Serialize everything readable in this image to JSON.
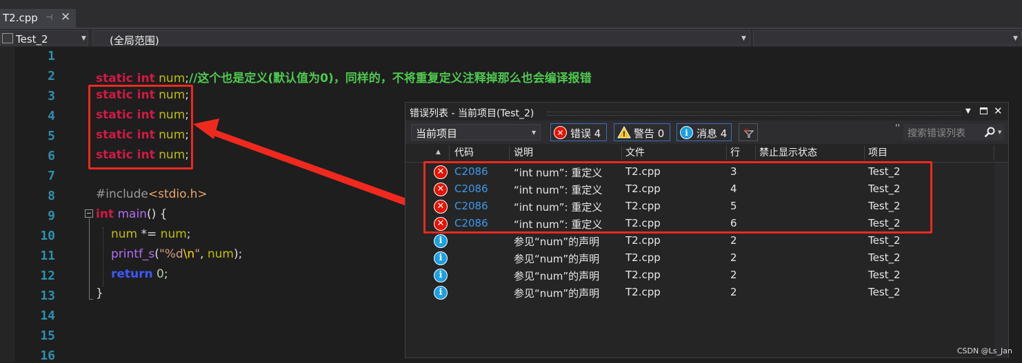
{
  "tab": {
    "title": "T2.cpp",
    "pin": "⊣",
    "close": "✕"
  },
  "nav": {
    "project": "Test_2",
    "scope": "(全局范围)"
  },
  "editor": {
    "line_numbers": [
      "1",
      "2",
      "3",
      "4",
      "5",
      "6",
      "7",
      "8",
      "9",
      "10",
      "11",
      "12",
      "13",
      "14",
      "15",
      "16"
    ],
    "line2": {
      "kw": "static int",
      "var": "num",
      "punct": ";",
      "comment": "//这个也是定义(默认值为0)，同样的，不将重复定义注释掉那么也会编译报错"
    },
    "dup_lines": [
      {
        "kw": "static int",
        "var": "num",
        "punct": ";"
      },
      {
        "kw": "static int",
        "var": "num",
        "punct": ";"
      },
      {
        "kw": "static int",
        "var": "num",
        "punct": ";"
      },
      {
        "kw": "static int",
        "var": "num",
        "punct": ";"
      }
    ],
    "line8": {
      "directive": "#include",
      "header": "<stdio.h>"
    },
    "line9": {
      "type": "int",
      "fn": "main",
      "rest": "() {"
    },
    "line10": {
      "var1": "num",
      "op": " *= ",
      "var2": "num",
      "end": ";"
    },
    "line11": {
      "fn": "printf_s",
      "open": "(",
      "str1": "\"%d",
      "esc": "\\n",
      "str2": "\"",
      "sep": ", ",
      "var": "num",
      "close": ");"
    },
    "line12": {
      "kw": "return",
      "num": "0",
      "end": ";"
    },
    "line13": {
      "brace": "}"
    }
  },
  "error_panel": {
    "title": "错误列表 - 当前项目(Test_2)",
    "scope_label": "当前项目",
    "filters": {
      "errors": "错误 4",
      "warnings": "警告 0",
      "messages": "消息 4"
    },
    "search_placeholder": "搜索错误列表",
    "columns": [
      "代码",
      "说明",
      "文件",
      "行",
      "禁止显示状态",
      "项目"
    ],
    "rows": [
      {
        "kind": "error",
        "code": "C2086",
        "desc": "“int num”: 重定义",
        "file": "T2.cpp",
        "line": "3",
        "state": "",
        "project": "Test_2"
      },
      {
        "kind": "error",
        "code": "C2086",
        "desc": "“int num”: 重定义",
        "file": "T2.cpp",
        "line": "4",
        "state": "",
        "project": "Test_2"
      },
      {
        "kind": "error",
        "code": "C2086",
        "desc": "“int num”: 重定义",
        "file": "T2.cpp",
        "line": "5",
        "state": "",
        "project": "Test_2"
      },
      {
        "kind": "error",
        "code": "C2086",
        "desc": "“int num”: 重定义",
        "file": "T2.cpp",
        "line": "6",
        "state": "",
        "project": "Test_2"
      },
      {
        "kind": "info",
        "code": "",
        "desc": "参见“num”的声明",
        "file": "T2.cpp",
        "line": "2",
        "state": "",
        "project": "Test_2"
      },
      {
        "kind": "info",
        "code": "",
        "desc": "参见“num”的声明",
        "file": "T2.cpp",
        "line": "2",
        "state": "",
        "project": "Test_2"
      },
      {
        "kind": "info",
        "code": "",
        "desc": "参见“num”的声明",
        "file": "T2.cpp",
        "line": "2",
        "state": "",
        "project": "Test_2"
      },
      {
        "kind": "info",
        "code": "",
        "desc": "参见“num”的声明",
        "file": "T2.cpp",
        "line": "2",
        "state": "",
        "project": "Test_2"
      }
    ]
  },
  "colors": {
    "error_red": "#e51400",
    "info_blue": "#1ba1e2",
    "annotation_red": "#f0291f",
    "line_number": "#2b91af"
  },
  "watermark": "CSDN @Ls_Jan"
}
